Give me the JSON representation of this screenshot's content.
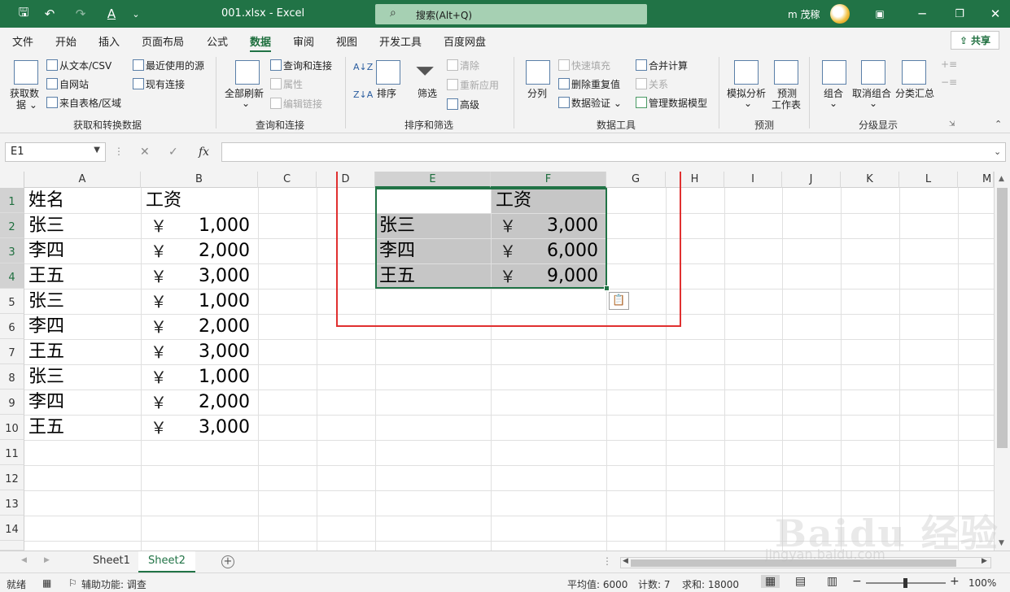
{
  "titlebar": {
    "filename": "001.xlsx  -  Excel",
    "search_placeholder": "搜索(Alt+Q)",
    "user": "m 茂稼"
  },
  "tabs": [
    "文件",
    "开始",
    "插入",
    "页面布局",
    "公式",
    "数据",
    "审阅",
    "视图",
    "开发工具",
    "百度网盘"
  ],
  "active_tab": "数据",
  "share_label": "共享",
  "ribbon": {
    "get_data": "获取数\n据",
    "get_data_l1": "获取数",
    "get_data_l2": "据",
    "from_text": "从文本/CSV",
    "from_web": "自网站",
    "from_table": "来自表格/区域",
    "recent_sources": "最近使用的源",
    "existing_conn": "现有连接",
    "group1": "获取和转换数据",
    "refresh_all": "全部刷新",
    "query_conn": "查询和连接",
    "properties": "属性",
    "edit_links": "编辑链接",
    "group2": "查询和连接",
    "sort": "排序",
    "filter": "筛选",
    "clear": "清除",
    "reapply": "重新应用",
    "advanced": "高级",
    "group3": "排序和筛选",
    "text_to_cols": "分列",
    "flash_fill": "快速填充",
    "remove_dup": "删除重复值",
    "data_valid": "数据验证",
    "consolidate": "合并计算",
    "relations": "关系",
    "data_model": "管理数据模型",
    "group4": "数据工具",
    "what_if": "模拟分析",
    "forecast_l1": "预测",
    "forecast_l2": "工作表",
    "group5": "预测",
    "group_btn": "组合",
    "ungroup": "取消组合",
    "subtotal": "分类汇总",
    "group6": "分级显示"
  },
  "namebox": "E1",
  "columns": [
    "A",
    "B",
    "C",
    "D",
    "E",
    "F",
    "G",
    "H",
    "I",
    "J",
    "K",
    "L",
    "M"
  ],
  "rows": [
    "1",
    "2",
    "3",
    "4",
    "5",
    "6",
    "7",
    "8",
    "9",
    "10",
    "11",
    "12",
    "13",
    "14"
  ],
  "cells": {
    "A": [
      "姓名",
      "张三",
      "李四",
      "王五",
      "张三",
      "李四",
      "王五",
      "张三",
      "李四",
      "王五"
    ],
    "B_header": "工资",
    "B_currency": "￥",
    "B": [
      "1,000",
      "2,000",
      "3,000",
      "1,000",
      "2,000",
      "3,000",
      "1,000",
      "2,000",
      "3,000"
    ],
    "E": [
      "张三",
      "李四",
      "王五"
    ],
    "F_header": "工资",
    "F": [
      "3,000",
      "6,000",
      "9,000"
    ]
  },
  "sheets": [
    "Sheet1",
    "Sheet2"
  ],
  "active_sheet": "Sheet2",
  "status": {
    "ready": "就绪",
    "accessibility": "辅助功能: 调查",
    "average": "平均值: 6000",
    "count": "计数: 7",
    "sum": "求和: 18000",
    "zoom": "100%"
  },
  "watermark": {
    "brand": "Baidu 经验",
    "url": "jingyan.baidu.com"
  },
  "colors": {
    "excel_green": "#217346",
    "highlight_box": "#e03030",
    "selection_fill": "#c6c6c6"
  }
}
